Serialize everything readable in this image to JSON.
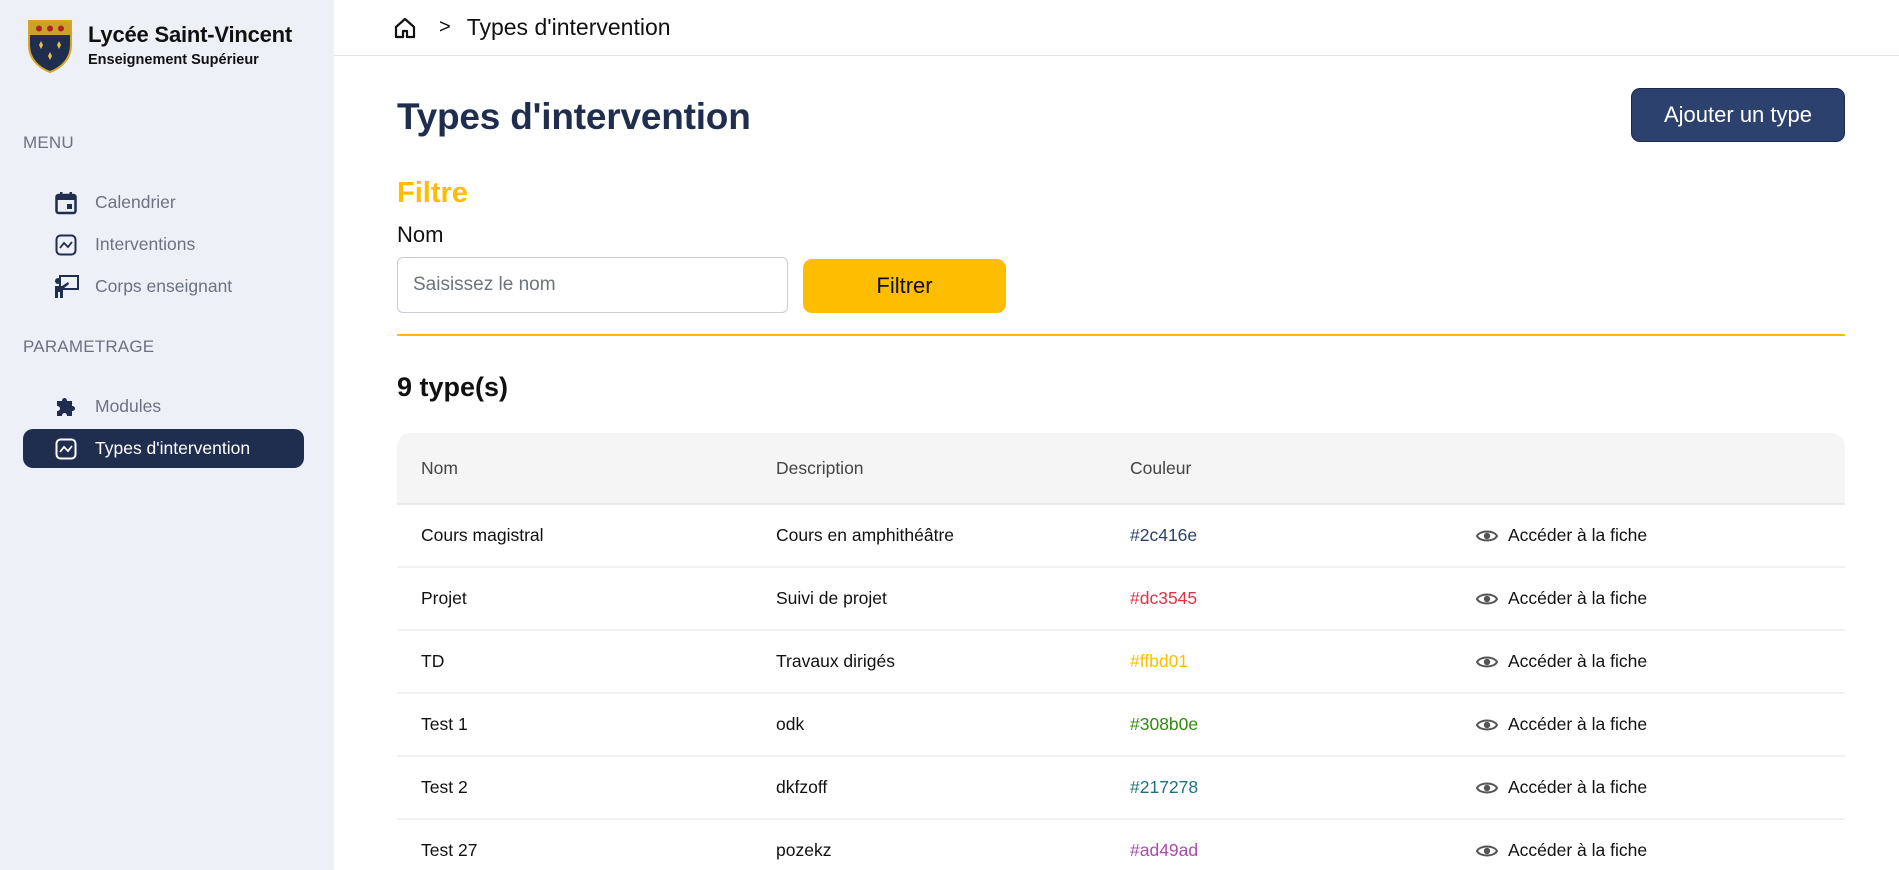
{
  "brand": {
    "title": "Lycée Saint-Vincent",
    "subtitle": "Enseignement Supérieur"
  },
  "sidebar": {
    "sections": [
      {
        "label": "MENU",
        "items": [
          {
            "label": "Calendrier",
            "icon": "calendar-icon"
          },
          {
            "label": "Interventions",
            "icon": "chart-line-icon"
          },
          {
            "label": "Corps enseignant",
            "icon": "teacher-icon"
          }
        ]
      },
      {
        "label": "PARAMETRAGE",
        "items": [
          {
            "label": "Modules",
            "icon": "puzzle-icon"
          },
          {
            "label": "Types d'intervention",
            "icon": "chart-line-icon",
            "active": true
          }
        ]
      }
    ]
  },
  "breadcrumb": {
    "separator": ">",
    "current": "Types d'intervention"
  },
  "page": {
    "title": "Types d'intervention",
    "add_button": "Ajouter un type"
  },
  "filter": {
    "title": "Filtre",
    "label": "Nom",
    "placeholder": "Saisissez le nom",
    "value": "",
    "button": "Filtrer"
  },
  "count_label": "9 type(s)",
  "table": {
    "headers": [
      "Nom",
      "Description",
      "Couleur",
      ""
    ],
    "action_label": "Accéder à la fiche",
    "rows": [
      {
        "name": "Cours magistral",
        "description": "Cours en amphithéâtre",
        "color": "#2c416e"
      },
      {
        "name": "Projet",
        "description": "Suivi de projet",
        "color": "#dc3545"
      },
      {
        "name": "TD",
        "description": "Travaux dirigés",
        "color": "#ffbd01"
      },
      {
        "name": "Test 1",
        "description": "odk",
        "color": "#308b0e"
      },
      {
        "name": "Test 2",
        "description": "dkfzoff",
        "color": "#217278"
      },
      {
        "name": "Test 27",
        "description": "pozekz",
        "color": "#ad49ad"
      }
    ]
  },
  "colors": {
    "primary": "#1f2d4f",
    "accent": "#ffbd01",
    "sidebar_bg": "#eef0f7"
  }
}
